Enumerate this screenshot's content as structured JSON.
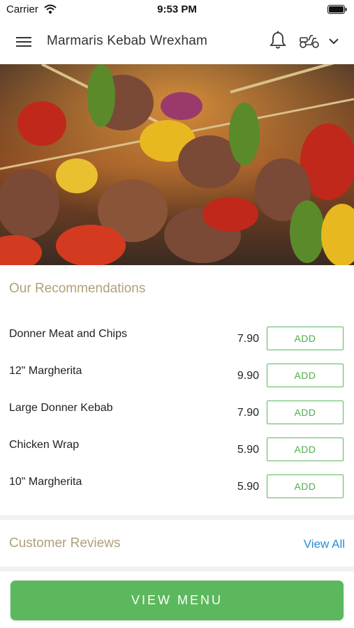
{
  "status_bar": {
    "carrier": "Carrier",
    "time": "9:53 PM"
  },
  "header": {
    "title": "Marmaris Kebab Wrexham",
    "icons": [
      "menu-icon",
      "bell-icon",
      "scooter-icon",
      "chevron-down-icon"
    ]
  },
  "hero": {
    "image": "grilled kebab skewers with peppers, onion and tomato"
  },
  "recommendations": {
    "title": "Our Recommendations",
    "items": [
      {
        "name": "Donner Meat and Chips",
        "price": "7.90",
        "action": "ADD"
      },
      {
        "name": "12\" Margherita",
        "price": "9.90",
        "action": "ADD"
      },
      {
        "name": "Large Donner Kebab",
        "price": "7.90",
        "action": "ADD"
      },
      {
        "name": "Chicken Wrap",
        "price": "5.90",
        "action": "ADD"
      },
      {
        "name": "10\" Margherita",
        "price": "5.90",
        "action": "ADD"
      }
    ]
  },
  "reviews": {
    "title": "Customer Reviews",
    "view_all": "View All"
  },
  "footer": {
    "view_menu": "VIEW MENU"
  },
  "colors": {
    "accent_green": "#5cb85c",
    "section_title": "#b0a07a",
    "link_blue": "#2a8dd4"
  }
}
